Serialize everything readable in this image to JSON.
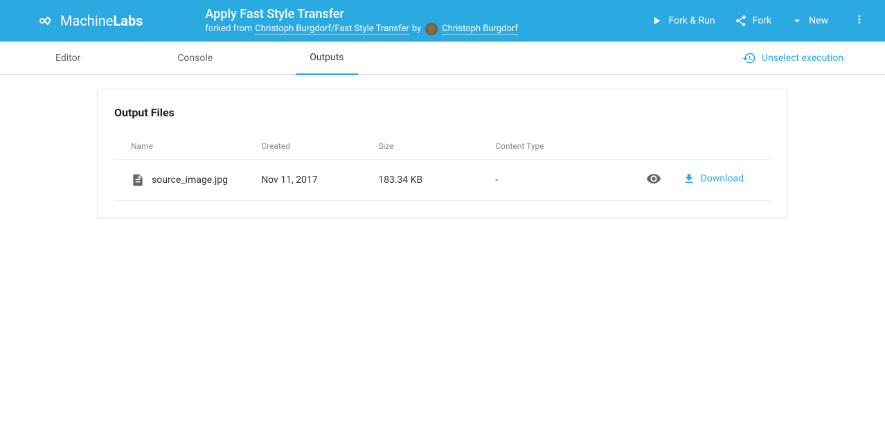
{
  "header": {
    "logo_prefix": "Machine",
    "logo_suffix": "Labs",
    "title": "Apply Fast Style Transfer",
    "forked_prefix": "forked from ",
    "forked_link": "Christoph Burgdorf/Fast Style Transfer",
    "by_text": " by ",
    "author": "Christoph Burgdorf",
    "actions": {
      "fork_run": "Fork & Run",
      "fork": "Fork",
      "new": "New"
    }
  },
  "tabs": {
    "editor": "Editor",
    "console": "Console",
    "outputs": "Outputs"
  },
  "unselect": "Unselect execution",
  "card": {
    "title": "Output Files",
    "columns": {
      "name": "Name",
      "created": "Created",
      "size": "Size",
      "content_type": "Content Type"
    },
    "rows": [
      {
        "name": "source_image.jpg",
        "created": "Nov 11, 2017",
        "size": "183.34 KB",
        "content_type": "-",
        "download": "Download"
      }
    ]
  }
}
